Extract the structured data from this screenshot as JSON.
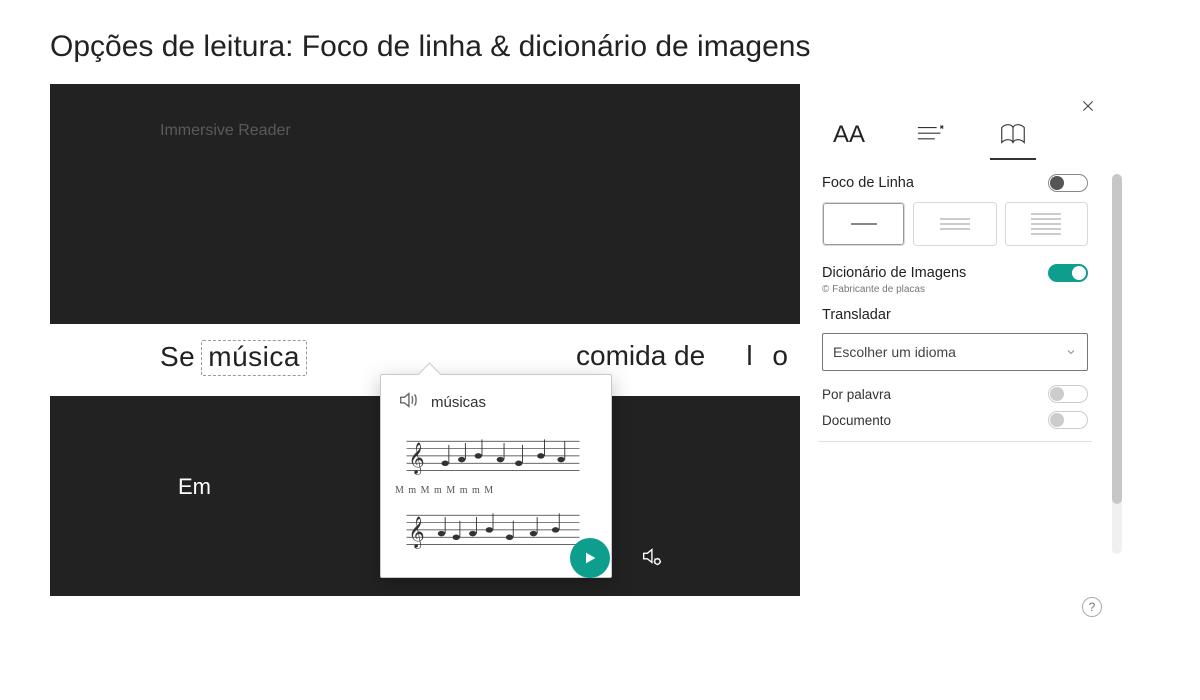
{
  "page": {
    "title": "Opções de leitura: Foco de linha &amp; dicionário de imagens"
  },
  "reader": {
    "header_label": "Immersive Reader",
    "focus_line": {
      "word_before": "Se",
      "selected_word": "música",
      "mid_word": "comida de",
      "right_fragment": "l o"
    },
    "line2": "Em",
    "dictionary_popup": {
      "word": "músicas"
    }
  },
  "sidebar": {
    "tab_text_label": "AA",
    "line_focus": {
      "label": "Foco de Linha",
      "enabled": false
    },
    "picture_dictionary": {
      "label": "Dicionário de Imagens",
      "enabled": true,
      "credit": "© Fabricante de placas"
    },
    "translate": {
      "label": "Transladar",
      "placeholder": "Escolher um idioma"
    },
    "by_word": {
      "label": "Por palavra",
      "enabled": false
    },
    "document": {
      "label": "Documento",
      "enabled": false
    }
  },
  "icons": {
    "help": "?"
  }
}
